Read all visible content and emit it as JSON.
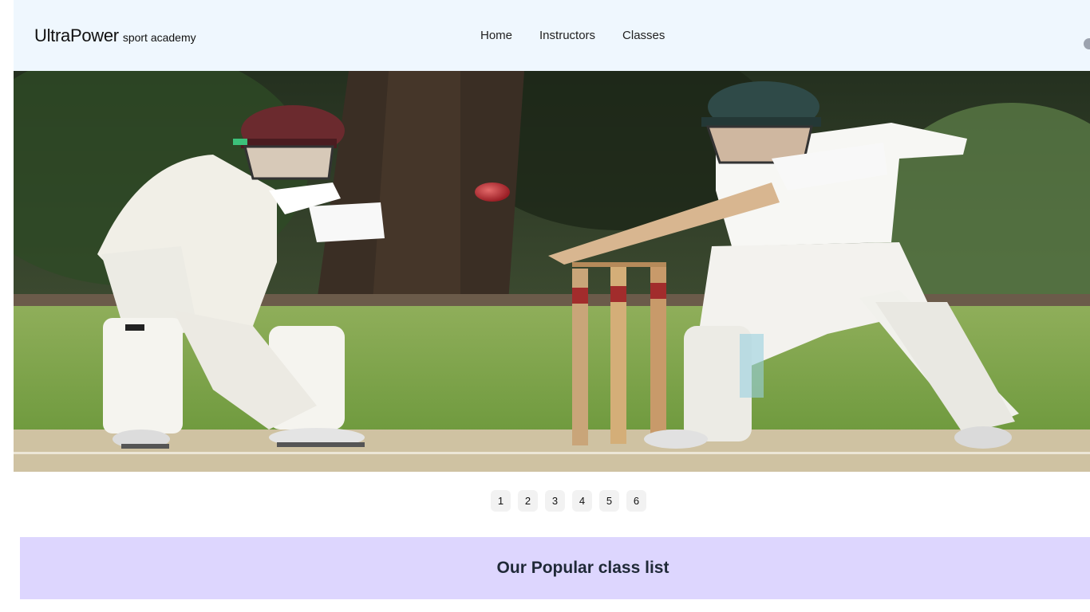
{
  "navbar": {
    "brand_name": "UltraPower",
    "brand_tagline": "sport academy",
    "links": [
      {
        "label": "Home"
      },
      {
        "label": "Instructors"
      },
      {
        "label": "Classes"
      }
    ]
  },
  "hero": {
    "image": "cricket-wicketkeeper-and-batsman-photo"
  },
  "carousel": {
    "pages": [
      "1",
      "2",
      "3",
      "4",
      "5",
      "6"
    ]
  },
  "section": {
    "title": "Our Popular class list"
  },
  "colors": {
    "navbar_bg": "#eff7fe",
    "section_bg": "#ddd6fe",
    "pager_bg": "#f2f2f2"
  }
}
